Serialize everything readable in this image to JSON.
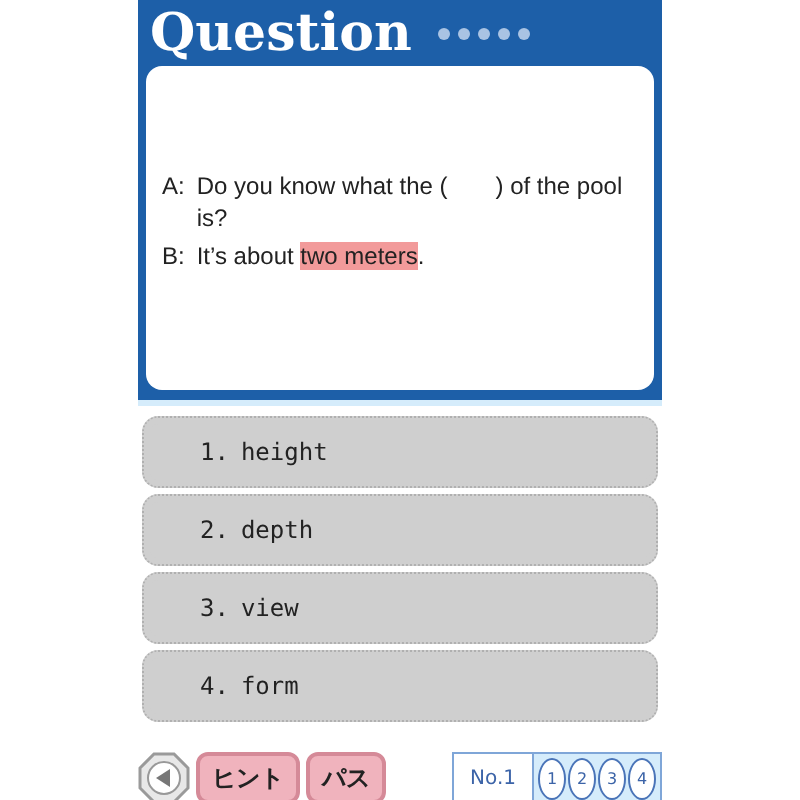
{
  "header": {
    "title": "Question"
  },
  "dialogue": [
    {
      "speaker": "A:",
      "segments": [
        {
          "text": "Do you know what the (　　) of the pool is?",
          "highlighted": false
        }
      ]
    },
    {
      "speaker": "B:",
      "segments": [
        {
          "text": "It’s about ",
          "highlighted": false
        },
        {
          "text": "two meters",
          "highlighted": true
        },
        {
          "text": ".",
          "highlighted": false
        }
      ]
    }
  ],
  "options": [
    {
      "number": "1.",
      "label": "height"
    },
    {
      "number": "2.",
      "label": "depth"
    },
    {
      "number": "3.",
      "label": "view"
    },
    {
      "number": "4.",
      "label": "form"
    }
  ],
  "buttons": [
    {
      "label": "ヒント"
    },
    {
      "label": "パス"
    }
  ],
  "pager": {
    "label": "No.1",
    "pages": [
      "1",
      "2",
      "3",
      "4"
    ]
  }
}
